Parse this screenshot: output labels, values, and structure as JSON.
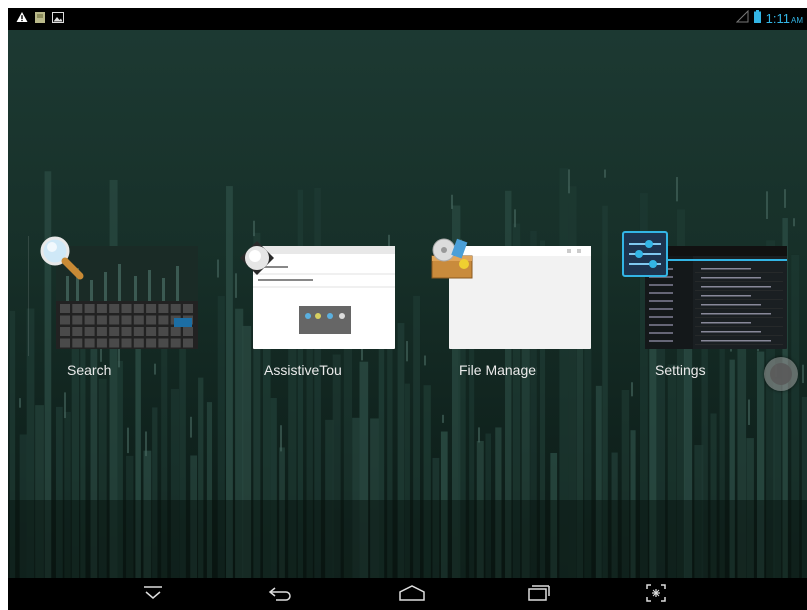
{
  "status_bar": {
    "time": "1:11",
    "time_suffix": "AM",
    "icons": [
      "warning-icon",
      "sd-card-icon",
      "picture-icon",
      "no-sim-signal-icon",
      "battery-icon"
    ]
  },
  "recents": [
    {
      "label": "Search",
      "icon": "search-magnifier-icon"
    },
    {
      "label": "AssistiveTouch",
      "icon": "assistive-touch-icon"
    },
    {
      "label": "File Manager",
      "icon": "file-manager-icon"
    },
    {
      "label": "Settings",
      "icon": "settings-sliders-icon"
    }
  ],
  "nav_bar": {
    "buttons": [
      "hide-keyboard-icon",
      "back-icon",
      "home-icon",
      "recent-apps-icon",
      "screenshot-icon"
    ]
  },
  "colors": {
    "accent": "#33b5e5",
    "background_top": "#1d3a33",
    "background_bottom": "#0a1612"
  }
}
